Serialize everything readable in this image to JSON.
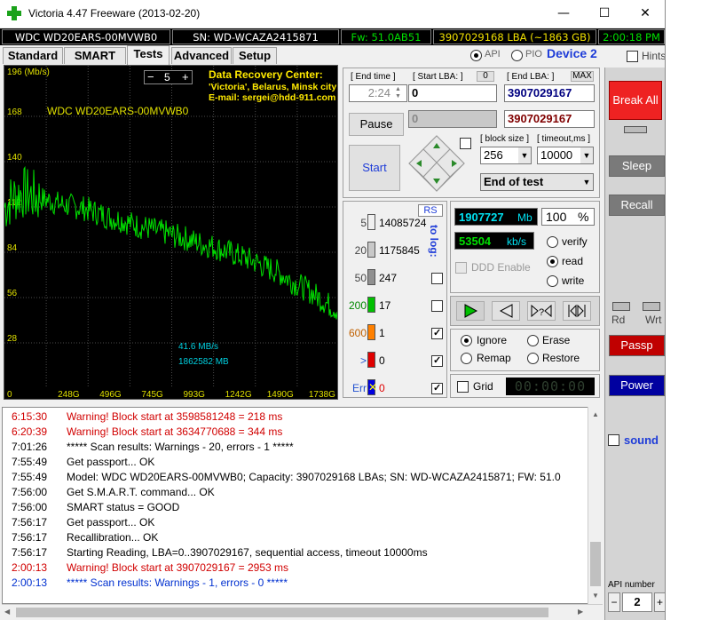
{
  "window": {
    "title": "Victoria 4.47  Freeware (2013-02-20)",
    "minimize": "—",
    "maximize": "☐",
    "close": "✕"
  },
  "infobar": {
    "model": "WDC WD20EARS-00MVWB0",
    "serial": "SN: WD-WCAZA2415871",
    "firmware": "Fw: 51.0AB51",
    "capacity": "3907029168 LBA (~1863 GB)",
    "clock": "2:00:18 PM"
  },
  "tabs": [
    "Standard",
    "SMART",
    "Tests",
    "Advanced",
    "Setup"
  ],
  "active_tab": "Tests",
  "mode": {
    "api_label": "API",
    "pio_label": "PIO",
    "device_label": "Device 2",
    "hints_label": "Hints"
  },
  "graph": {
    "y_unit_label": "196 (Mb/s)",
    "drive_label": "WDC WD20EARS-00MVWB0",
    "spin_value": "5",
    "spin_minus": "−",
    "spin_plus": "+",
    "drc_title": "Data Recovery Center:",
    "drc_line1": "'Victoria', Belarus, Minsk city",
    "drc_line2": "E-mail: sergei@hdd-911.com",
    "speed_readout": "41.6 MB/s",
    "position_readout": "1862582 MB",
    "grid_color": "#4a4a4a",
    "line_color": "#00e000",
    "label_color": "#e0e000"
  },
  "chart_data": {
    "type": "line",
    "title": "",
    "xlabel": "",
    "ylabel": "196 (Mb/s)",
    "y_ticks": [
      28,
      56,
      84,
      112,
      140,
      168
    ],
    "x_ticks": [
      "0",
      "248G",
      "496G",
      "745G",
      "993G",
      "1242G",
      "1490G",
      "1738G"
    ],
    "ylim": [
      0,
      196
    ],
    "xlim_gb": [
      0,
      1863
    ],
    "series": [
      {
        "x_gb": [
          0,
          50,
          100,
          150,
          200,
          250,
          300,
          350,
          400,
          450,
          500,
          550,
          600,
          650,
          700,
          750,
          800,
          850,
          900,
          950,
          1000,
          1050,
          1100,
          1150,
          1200,
          1250,
          1300,
          1350,
          1400,
          1450,
          1500,
          1550,
          1600,
          1650,
          1700,
          1750,
          1800,
          1863
        ],
        "y": [
          112,
          118,
          121,
          119,
          117,
          116,
          114,
          113,
          112,
          111,
          109,
          107,
          105,
          104,
          102,
          100,
          99,
          97,
          96,
          94,
          93,
          91,
          89,
          88,
          86,
          84,
          82,
          80,
          78,
          75,
          73,
          70,
          66,
          63,
          60,
          56,
          52,
          48
        ]
      }
    ]
  },
  "controls": {
    "end_time_label": "[ End time ]",
    "end_time_value": "2:24",
    "start_lba_label": "[ Start LBA: ]",
    "start_lba_reset": "0",
    "start_lba_value": "0",
    "end_lba_label": "[ End LBA: ]",
    "end_lba_max": "MAX",
    "end_lba_value": "3907029167",
    "current_lba_value": "0",
    "current_end_value": "3907029167",
    "pause_label": "Pause",
    "start_label": "Start",
    "block_size_label": "[ block size ]",
    "block_size_value": "256",
    "timeout_label": "[ timeout,ms ]",
    "timeout_value": "10000",
    "end_action_value": "End of test"
  },
  "stats": {
    "rs_label": "RS",
    "to_log_label": "to log:",
    "rows": [
      {
        "label": "5",
        "count": "14085724",
        "color": "#f0f0f0",
        "checked": false
      },
      {
        "label": "20",
        "count": "1175845",
        "color": "#c8c8c8",
        "checked": false
      },
      {
        "label": "50",
        "count": "247",
        "color": "#909090",
        "checked": false
      },
      {
        "label": "200",
        "count": "17",
        "color": "#00c000",
        "checked": false
      },
      {
        "label": "600",
        "count": "1",
        "color": "#ff8000",
        "checked": true
      },
      {
        "label": ">",
        "count": "0",
        "color": "#e00000",
        "checked": true
      },
      {
        "label": "Err",
        "count": "0",
        "color": "#0000e0",
        "checked": true
      }
    ]
  },
  "progress": {
    "mb_value": "1907727",
    "mb_unit": "Mb",
    "percent_value": "100",
    "percent_unit": "%",
    "speed_value": "53504",
    "speed_unit": "kb/s",
    "ddd_label": "DDD Enable",
    "verify_label": "verify",
    "read_label": "read",
    "write_label": "write",
    "mode_selected": "read"
  },
  "actions": {
    "ignore_label": "Ignore",
    "erase_label": "Erase",
    "remap_label": "Remap",
    "restore_label": "Restore",
    "grid_label": "Grid",
    "timer_value": "00:00:00",
    "selected": "Ignore"
  },
  "right": {
    "break_all": "Break All",
    "sleep": "Sleep",
    "recall": "Recall",
    "rd": "Rd",
    "wrt": "Wrt",
    "passp": "Passp",
    "power": "Power",
    "sound": "sound",
    "api_number_label": "API number",
    "api_number_value": "2",
    "api_minus": "−",
    "api_plus": "+"
  },
  "log": [
    {
      "time": "6:15:30",
      "msg": "Warning! Block start at 3598581248 = 218 ms",
      "kind": "red"
    },
    {
      "time": "6:20:39",
      "msg": "Warning! Block start at 3634770688 = 344 ms",
      "kind": "red"
    },
    {
      "time": "7:01:26",
      "msg": "***** Scan results: Warnings - 20, errors - 1 *****",
      "kind": "normal"
    },
    {
      "time": "7:55:49",
      "msg": "Get passport... OK",
      "kind": "normal"
    },
    {
      "time": "7:55:49",
      "msg": "Model: WDC WD20EARS-00MVWB0; Capacity: 3907029168 LBAs; SN: WD-WCAZA2415871; FW: 51.0",
      "kind": "normal"
    },
    {
      "time": "7:56:00",
      "msg": "Get S.M.A.R.T. command... OK",
      "kind": "normal"
    },
    {
      "time": "7:56:00",
      "msg": "SMART status = GOOD",
      "kind": "normal"
    },
    {
      "time": "7:56:17",
      "msg": "Get passport... OK",
      "kind": "normal"
    },
    {
      "time": "7:56:17",
      "msg": "Recallibration... OK",
      "kind": "normal"
    },
    {
      "time": "7:56:17",
      "msg": "Starting Reading, LBA=0..3907029167, sequential access, timeout 10000ms",
      "kind": "normal"
    },
    {
      "time": "2:00:13",
      "msg": "Warning! Block start at 3907029167 = 2953 ms",
      "kind": "red"
    },
    {
      "time": "2:00:13",
      "msg": "***** Scan results: Warnings - 1, errors - 0 *****",
      "kind": "blue"
    }
  ]
}
